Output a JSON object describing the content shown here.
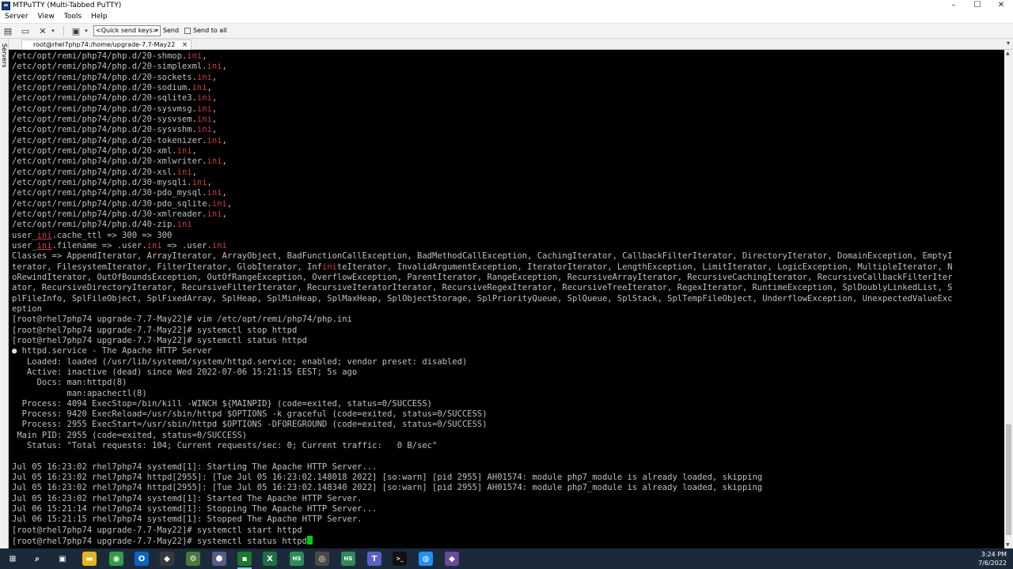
{
  "window": {
    "title": "MTPuTTY (Multi-Tabbed PuTTY)",
    "controls": [
      "–",
      "☐",
      "✕"
    ]
  },
  "menu": [
    "Server",
    "View",
    "Tools",
    "Help"
  ],
  "toolbar": {
    "quick_send_placeholder": "<Quick send keys>",
    "send_label": "Send",
    "send_to_all_label": "Send to all"
  },
  "sidebar": {
    "label": "Servers"
  },
  "tab": {
    "title": "root@rhel7php74:/home/upgrade-7.7-May22",
    "close": "×"
  },
  "terminal": {
    "lines": [
      {
        "segments": [
          {
            "t": "/etc/opt/remi/php74/php.d/20-shmop."
          },
          {
            "t": "ini",
            "c": "ini"
          },
          {
            "t": ","
          }
        ]
      },
      {
        "segments": [
          {
            "t": "/etc/opt/remi/php74/php.d/20-simplexml."
          },
          {
            "t": "ini",
            "c": "ini"
          },
          {
            "t": ","
          }
        ]
      },
      {
        "segments": [
          {
            "t": "/etc/opt/remi/php74/php.d/20-sockets."
          },
          {
            "t": "ini",
            "c": "ini"
          },
          {
            "t": ","
          }
        ]
      },
      {
        "segments": [
          {
            "t": "/etc/opt/remi/php74/php.d/20-sodium."
          },
          {
            "t": "ini",
            "c": "ini"
          },
          {
            "t": ","
          }
        ]
      },
      {
        "segments": [
          {
            "t": "/etc/opt/remi/php74/php.d/20-sqlite3."
          },
          {
            "t": "ini",
            "c": "ini"
          },
          {
            "t": ","
          }
        ]
      },
      {
        "segments": [
          {
            "t": "/etc/opt/remi/php74/php.d/20-sysvmsg."
          },
          {
            "t": "ini",
            "c": "ini"
          },
          {
            "t": ","
          }
        ]
      },
      {
        "segments": [
          {
            "t": "/etc/opt/remi/php74/php.d/20-sysvsem."
          },
          {
            "t": "ini",
            "c": "ini"
          },
          {
            "t": ","
          }
        ]
      },
      {
        "segments": [
          {
            "t": "/etc/opt/remi/php74/php.d/20-sysvshm."
          },
          {
            "t": "ini",
            "c": "ini"
          },
          {
            "t": ","
          }
        ]
      },
      {
        "segments": [
          {
            "t": "/etc/opt/remi/php74/php.d/20-tokenizer."
          },
          {
            "t": "ini",
            "c": "ini"
          },
          {
            "t": ","
          }
        ]
      },
      {
        "segments": [
          {
            "t": "/etc/opt/remi/php74/php.d/20-xml."
          },
          {
            "t": "ini",
            "c": "ini"
          },
          {
            "t": ","
          }
        ]
      },
      {
        "segments": [
          {
            "t": "/etc/opt/remi/php74/php.d/20-xmlwriter."
          },
          {
            "t": "ini",
            "c": "ini"
          },
          {
            "t": ","
          }
        ]
      },
      {
        "segments": [
          {
            "t": "/etc/opt/remi/php74/php.d/20-xsl."
          },
          {
            "t": "ini",
            "c": "ini"
          },
          {
            "t": ","
          }
        ]
      },
      {
        "segments": [
          {
            "t": "/etc/opt/remi/php74/php.d/30-mysqli."
          },
          {
            "t": "ini",
            "c": "ini"
          },
          {
            "t": ","
          }
        ]
      },
      {
        "segments": [
          {
            "t": "/etc/opt/remi/php74/php.d/30-pdo_mysql."
          },
          {
            "t": "ini",
            "c": "ini"
          },
          {
            "t": ","
          }
        ]
      },
      {
        "segments": [
          {
            "t": "/etc/opt/remi/php74/php.d/30-pdo_sqlite."
          },
          {
            "t": "ini",
            "c": "ini"
          },
          {
            "t": ","
          }
        ]
      },
      {
        "segments": [
          {
            "t": "/etc/opt/remi/php74/php.d/30-xmlreader."
          },
          {
            "t": "ini",
            "c": "ini"
          },
          {
            "t": ","
          }
        ]
      },
      {
        "segments": [
          {
            "t": "/etc/opt/remi/php74/php.d/40-zip."
          },
          {
            "t": "ini",
            "c": "ini"
          }
        ]
      },
      {
        "segments": [
          {
            "t": "user_"
          },
          {
            "t": "ini",
            "c": "ini ul"
          },
          {
            "t": ".cache_ttl => 300 => 300"
          }
        ]
      },
      {
        "segments": [
          {
            "t": "user_"
          },
          {
            "t": "ini",
            "c": "ini ul"
          },
          {
            "t": ".filename => .user."
          },
          {
            "t": "ini",
            "c": "ini"
          },
          {
            "t": " => .user."
          },
          {
            "t": "ini",
            "c": "ini"
          }
        ]
      },
      {
        "segments": [
          {
            "t": "Classes => AppendIterator, ArrayIterator, ArrayObject, BadFunctionCallException, BadMethodCallException, CachingIterator, CallbackFilterIterator, DirectoryIterator, DomainException, EmptyI"
          }
        ]
      },
      {
        "segments": [
          {
            "t": "terator, FilesystemIterator, FilterIterator, GlobIterator, Inf"
          },
          {
            "t": "ini",
            "c": "ini"
          },
          {
            "t": "teIterator, InvalidArgumentException, IteratorIterator, LengthException, LimitIterator, LogicException, MultipleIterator, N"
          }
        ]
      },
      {
        "segments": [
          {
            "t": "oRewindIterator, OutOfBoundsException, OutOfRangeException, OverflowException, ParentIterator, RangeException, RecursiveArrayIterator, RecursiveCachingIterator, RecursiveCallbackFilterIter"
          }
        ]
      },
      {
        "segments": [
          {
            "t": "ator, RecursiveDirectoryIterator, RecursiveFilterIterator, RecursiveIteratorIterator, RecursiveRegexIterator, RecursiveTreeIterator, RegexIterator, RuntimeException, SplDoublyLinkedList, S"
          }
        ]
      },
      {
        "segments": [
          {
            "t": "plFileInfo, SplFileObject, SplFixedArray, SplHeap, SplMinHeap, SplMaxHeap, SplObjectStorage, SplPriorityQueue, SplQueue, SplStack, SplTempFileObject, UnderflowException, UnexpectedValueExc"
          }
        ]
      },
      {
        "segments": [
          {
            "t": "eption"
          }
        ]
      },
      {
        "segments": [
          {
            "t": "[root@rhel7php74 upgrade-7.7-May22]# vim /etc/opt/remi/php74/php.ini"
          }
        ]
      },
      {
        "segments": [
          {
            "t": "[root@rhel7php74 upgrade-7.7-May22]# systemctl stop httpd"
          }
        ]
      },
      {
        "segments": [
          {
            "t": "[root@rhel7php74 upgrade-7.7-May22]# systemctl status httpd"
          }
        ]
      },
      {
        "segments": [
          {
            "t": "●",
            "c": "dot"
          },
          {
            "t": " httpd.service - The Apache HTTP Server"
          }
        ]
      },
      {
        "segments": [
          {
            "t": "   Loaded: loaded (/usr/lib/systemd/system/httpd.service; enabled; vendor preset: disabled)"
          }
        ]
      },
      {
        "segments": [
          {
            "t": "   Active: inactive (dead) since Wed 2022-07-06 15:21:15 EEST; 5s ago"
          }
        ]
      },
      {
        "segments": [
          {
            "t": "     Docs: man:httpd(8)"
          }
        ]
      },
      {
        "segments": [
          {
            "t": "           man:apachectl(8)"
          }
        ]
      },
      {
        "segments": [
          {
            "t": "  Process: 4094 ExecStop=/bin/kill -WINCH ${MAINPID} (code=exited, status=0/SUCCESS)"
          }
        ]
      },
      {
        "segments": [
          {
            "t": "  Process: 9420 ExecReload=/usr/sbin/httpd $OPTIONS -k graceful (code=exited, status=0/SUCCESS)"
          }
        ]
      },
      {
        "segments": [
          {
            "t": "  Process: 2955 ExecStart=/usr/sbin/httpd $OPTIONS -DFOREGROUND (code=exited, status=0/SUCCESS)"
          }
        ]
      },
      {
        "segments": [
          {
            "t": " Main PID: 2955 (code=exited, status=0/SUCCESS)"
          }
        ]
      },
      {
        "segments": [
          {
            "t": "   Status: \"Total requests: 104; Current requests/sec: 0; Current traffic:   0 B/sec\""
          }
        ]
      },
      {
        "segments": [
          {
            "t": ""
          }
        ]
      },
      {
        "segments": [
          {
            "t": "Jul 05 16:23:02 rhel7php74 systemd[1]: Starting The Apache HTTP Server..."
          }
        ]
      },
      {
        "segments": [
          {
            "t": "Jul 05 16:23:02 rhel7php74 httpd[2955]: [Tue Jul 05 16:23:02.148018 2022] [so:warn] [pid 2955] AH01574: module php7_module is already loaded, skipping"
          }
        ]
      },
      {
        "segments": [
          {
            "t": "Jul 05 16:23:02 rhel7php74 httpd[2955]: [Tue Jul 05 16:23:02.148340 2022] [so:warn] [pid 2955] AH01574: module php7_module is already loaded, skipping"
          }
        ]
      },
      {
        "segments": [
          {
            "t": "Jul 05 16:23:02 rhel7php74 systemd[1]: Started The Apache HTTP Server."
          }
        ]
      },
      {
        "segments": [
          {
            "t": "Jul 06 15:21:14 rhel7php74 systemd[1]: Stopping The Apache HTTP Server..."
          }
        ]
      },
      {
        "segments": [
          {
            "t": "Jul 06 15:21:15 rhel7php74 systemd[1]: Stopped The Apache HTTP Server."
          }
        ]
      },
      {
        "segments": [
          {
            "t": "[root@rhel7php74 upgrade-7.7-May22]# systemctl start httpd"
          }
        ]
      },
      {
        "segments": [
          {
            "t": "[root@rhel7php74 upgrade-7.7-May22]# systemctl status httpd"
          }
        ],
        "cursor": true
      }
    ]
  },
  "colors": {
    "terminal_bg": "#000000",
    "terminal_fg": "#c0c0c0",
    "ini_highlight": "#cd3c3c",
    "cursor": "#00d000",
    "taskbar_bg": "#1b2a3a"
  },
  "taskbar": {
    "icons": [
      {
        "name": "windows-start-icon",
        "glyph": "⊞",
        "bg": "transparent"
      },
      {
        "name": "search-icon",
        "glyph": "⌕",
        "bg": "transparent"
      },
      {
        "name": "task-view-icon",
        "glyph": "▣",
        "bg": "transparent"
      },
      {
        "name": "file-explorer-icon",
        "glyph": "▬",
        "bg": "#e8b41c"
      },
      {
        "name": "chrome-icon",
        "glyph": "◉",
        "bg": "#2f9e44"
      },
      {
        "name": "outlook-icon",
        "glyph": "O",
        "bg": "#0a64c8"
      },
      {
        "name": "git-icon",
        "glyph": "◆",
        "bg": "#3a3a3a"
      },
      {
        "name": "tool-icon",
        "glyph": "⚙",
        "bg": "#4a7a3a"
      },
      {
        "name": "cube-icon",
        "glyph": "⬢",
        "bg": "#5a5a8a"
      },
      {
        "name": "mtputty-icon",
        "glyph": "▪",
        "bg": "#1c7a2c"
      },
      {
        "name": "excel-icon",
        "glyph": "X",
        "bg": "#1e7145"
      },
      {
        "name": "hs-icon",
        "glyph": "HS",
        "bg": "#2e8b57"
      },
      {
        "name": "vpn-icon",
        "glyph": "◎",
        "bg": "#4a4a4a"
      },
      {
        "name": "hs2-icon",
        "glyph": "HS",
        "bg": "#2e8b57"
      },
      {
        "name": "teams-icon",
        "glyph": "T",
        "bg": "#5b5fc7"
      },
      {
        "name": "terminal-icon",
        "glyph": ">_",
        "bg": "#111111"
      },
      {
        "name": "network-icon",
        "glyph": "◍",
        "bg": "#1e90ff"
      },
      {
        "name": "git2-icon",
        "glyph": "◆",
        "bg": "#6a4a9a"
      }
    ],
    "time": "3:24 PM",
    "date": "7/6/2022"
  }
}
